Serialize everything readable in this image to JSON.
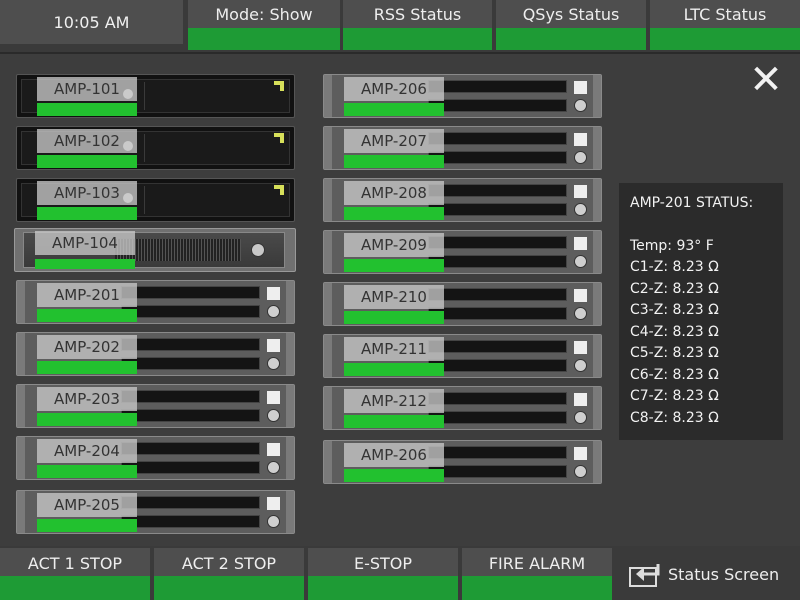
{
  "header": {
    "clock": "10:05 AM",
    "tabs": [
      {
        "label": "Mode: Show"
      },
      {
        "label": "RSS Status"
      },
      {
        "label": "QSys Status"
      },
      {
        "label": "LTC Status"
      }
    ]
  },
  "amps": {
    "left": [
      "AMP-101",
      "AMP-102",
      "AMP-103",
      "AMP-104",
      "AMP-201",
      "AMP-202",
      "AMP-203",
      "AMP-204",
      "AMP-205"
    ],
    "right": [
      "AMP-206",
      "AMP-207",
      "AMP-208",
      "AMP-209",
      "AMP-210",
      "AMP-211",
      "AMP-212",
      "AMP-206"
    ]
  },
  "status": {
    "title": "AMP-201 STATUS:",
    "temp": "Temp: 93° F",
    "channels": [
      "C1-Z: 8.23 Ω",
      "C2-Z: 8.23 Ω",
      "C3-Z: 8.23 Ω",
      "C4-Z: 8.23 Ω",
      "C5-Z: 8.23 Ω",
      "C6-Z: 8.23 Ω",
      "C7-Z: 8.23 Ω",
      "C8-Z: 8.23 Ω"
    ]
  },
  "footer": {
    "buttons": [
      {
        "label": "ACT 1 STOP"
      },
      {
        "label": "ACT 2 STOP"
      },
      {
        "label": "E-STOP"
      },
      {
        "label": "FIRE ALARM"
      }
    ],
    "status_screen": "Status Screen"
  },
  "colors": {
    "indicator_green": "#1e9b35",
    "amp_label_green": "#22c12f"
  },
  "icons": {
    "close": "close-icon",
    "back": "back-arrow-icon"
  }
}
